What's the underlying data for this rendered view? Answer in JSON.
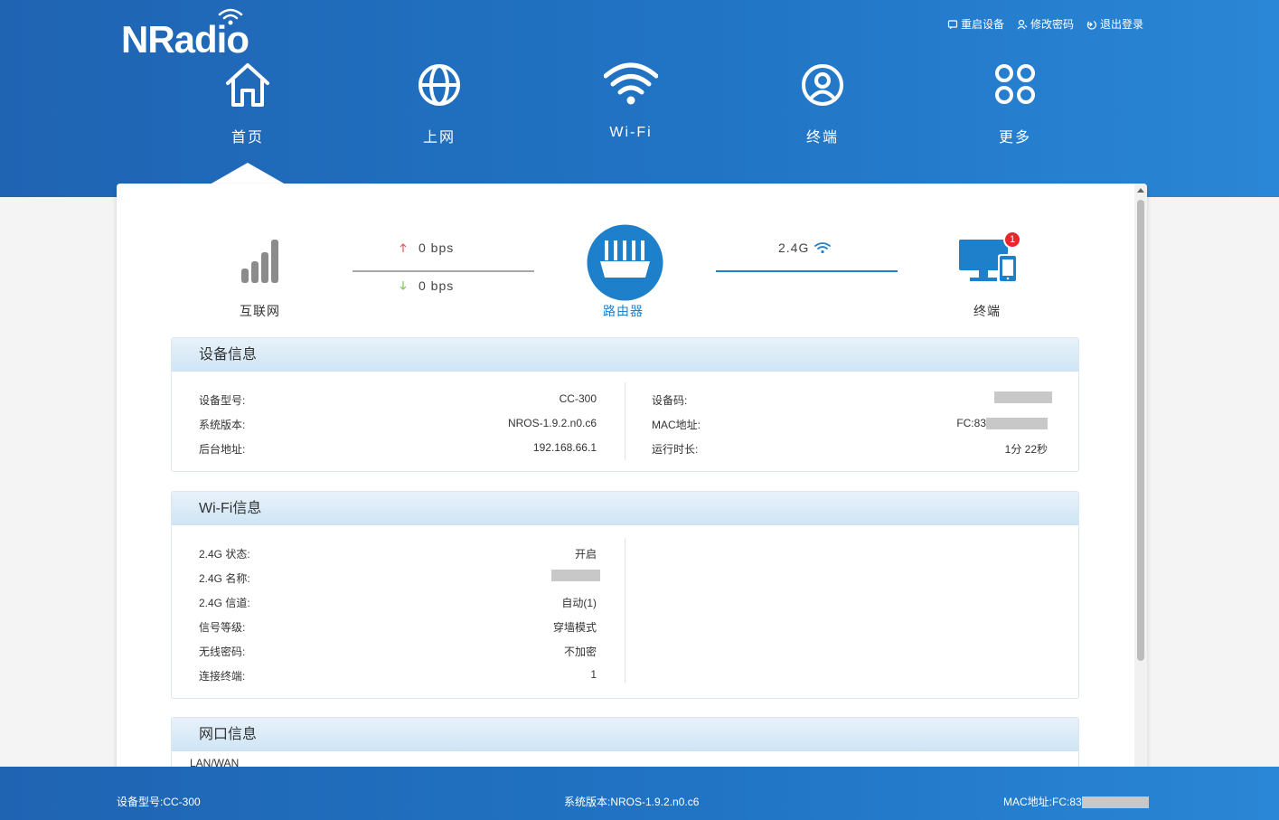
{
  "brand": {
    "logo": "NRadio"
  },
  "top_actions": {
    "reboot": "重启设备",
    "change_password": "修改密码",
    "logout": "退出登录"
  },
  "nav": {
    "home": "首页",
    "internet": "上网",
    "wifi": "Wi-Fi",
    "terminal": "终端",
    "more": "更多"
  },
  "topology": {
    "internet_label": "互联网",
    "upload_speed": "0 bps",
    "download_speed": "0 bps",
    "router_label": "路由器",
    "band": "2.4G",
    "terminal_label": "终端",
    "terminal_count": "1"
  },
  "device_info": {
    "title": "设备信息",
    "model_label": "设备型号:",
    "model_value": "CC-300",
    "version_label": "系统版本:",
    "version_value": "NROS-1.9.2.n0.c6",
    "admin_label": "后台地址:",
    "admin_value": "192.168.66.1",
    "code_label": "设备码:",
    "mac_label": "MAC地址:",
    "mac_value": "FC:83",
    "uptime_label": "运行时长:",
    "uptime_value": "1分 22秒"
  },
  "wifi_info": {
    "title": "Wi-Fi信息",
    "status_label": "2.4G 状态:",
    "status_value": "开启",
    "name_label": "2.4G 名称:",
    "channel_label": "2.4G 信道:",
    "channel_value": "自动(1)",
    "level_label": "信号等级:",
    "level_value": "穿墙模式",
    "password_label": "无线密码:",
    "password_value": "不加密",
    "clients_label": "连接终端:",
    "clients_value": "1"
  },
  "port_info": {
    "title": "网口信息",
    "lan_wan": "LAN/WAN"
  },
  "footer": {
    "model": "设备型号:CC-300",
    "version": "系统版本:NROS-1.9.2.n0.c6",
    "mac": "MAC地址:FC:83"
  },
  "colors": {
    "header_blue": "#2174c4",
    "accent": "#1e7fcb",
    "upload_arrow": "#e05a5a",
    "download_arrow": "#7fc45a",
    "badge": "#e8262b"
  },
  "icons": [
    "home-icon",
    "globe-icon",
    "wifi-icon",
    "user-circle-icon",
    "more-grid-icon",
    "signal-bars-icon",
    "router-icon",
    "monitor-phone-icon"
  ]
}
